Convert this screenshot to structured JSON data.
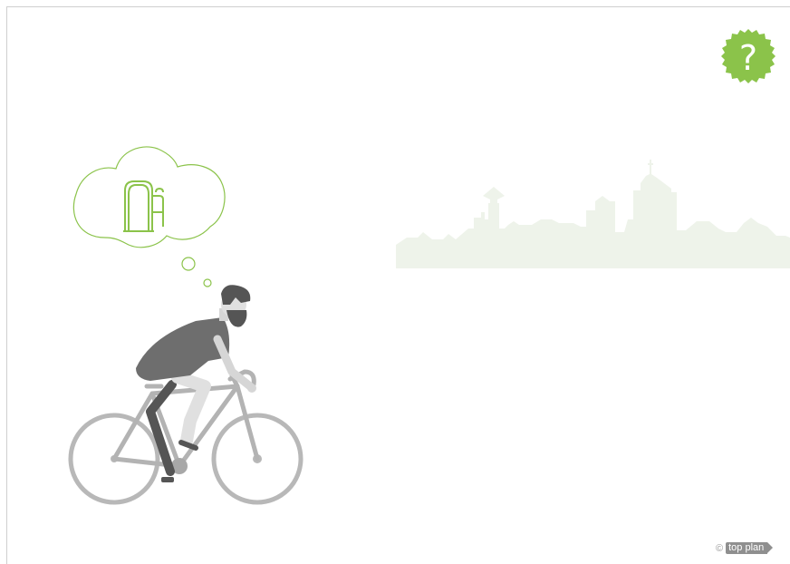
{
  "help": {
    "label": "?",
    "icon": "question-badge-icon",
    "color": "#8bc34a"
  },
  "footer": {
    "copyright_symbol": "©",
    "brand": "top plan"
  },
  "scene": {
    "thought_icon": "bike-rack-icon",
    "character": "cyclist-illustration",
    "background": "city-skyline-silhouette"
  },
  "colors": {
    "accent": "#8bc34a",
    "skyline": "#eef3ea",
    "cyclist_dark": "#6e6e6e",
    "cyclist_light": "#bdbdbd"
  }
}
